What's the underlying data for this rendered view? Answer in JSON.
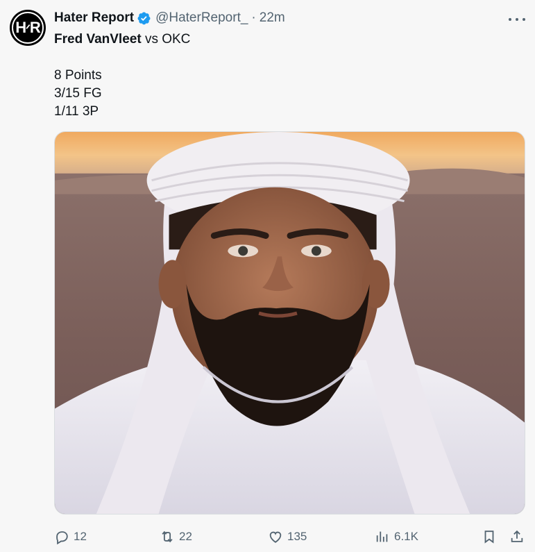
{
  "author": {
    "display_name": "Hater Report",
    "handle": "@HaterReport_",
    "separator": "·",
    "time": "22m",
    "avatar_text": "H·R",
    "verified": true
  },
  "tweet": {
    "line1_bold": "Fred VanVleet",
    "line1_rest": " vs OKC",
    "stats": [
      "8 Points",
      "3/15 FG",
      "1/11 3P"
    ]
  },
  "media": {
    "icon": "photo",
    "description_colors": {
      "sky": "#f3b874",
      "desert": "#8a7066",
      "robe": "#e9e6ee"
    }
  },
  "actions": {
    "reply_count": "12",
    "repost_count": "22",
    "like_count": "135",
    "views_count": "6.1K"
  },
  "colors": {
    "text": "#0f1419",
    "secondary": "#536471",
    "verified": "#1d9bf0",
    "background": "#f7f7f7"
  }
}
